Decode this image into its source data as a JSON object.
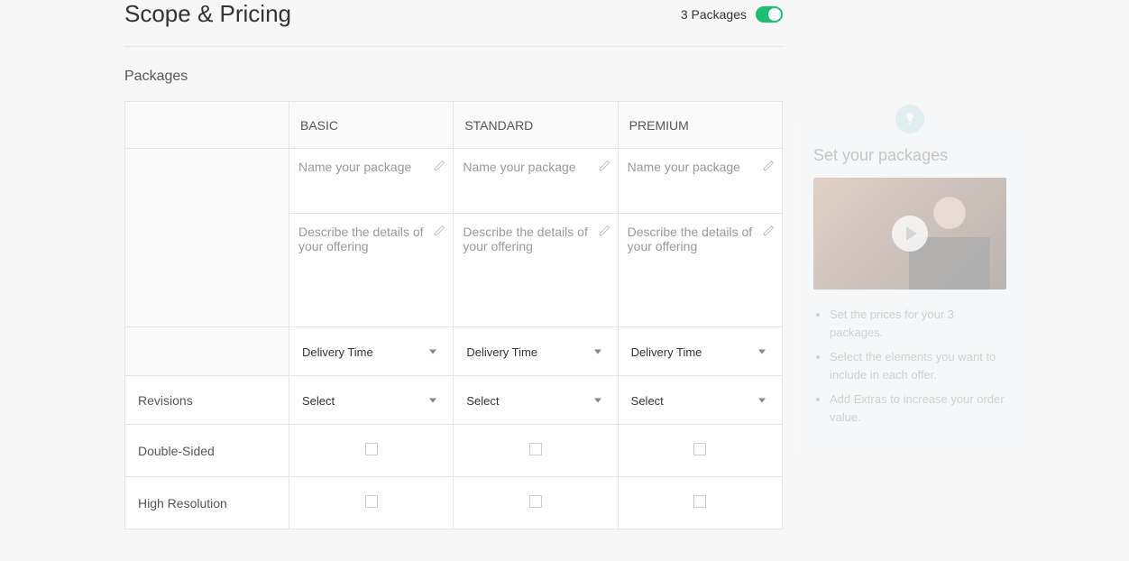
{
  "header": {
    "title": "Scope & Pricing",
    "toggle_label": "3 Packages"
  },
  "packages_section_label": "Packages",
  "columns": {
    "basic": "BASIC",
    "standard": "STANDARD",
    "premium": "PREMIUM"
  },
  "placeholders": {
    "name": "Name your package",
    "describe": "Describe the details of your offering",
    "delivery": "Delivery Time",
    "select": "Select"
  },
  "rows": {
    "revisions": "Revisions",
    "double_sided": "Double-Sided",
    "high_resolution": "High Resolution"
  },
  "tips": {
    "title": "Set your packages",
    "items": [
      "Set the prices for your 3 packages.",
      "Select the elements you want to include in each offer.",
      "Add Extras to increase your order value."
    ]
  }
}
